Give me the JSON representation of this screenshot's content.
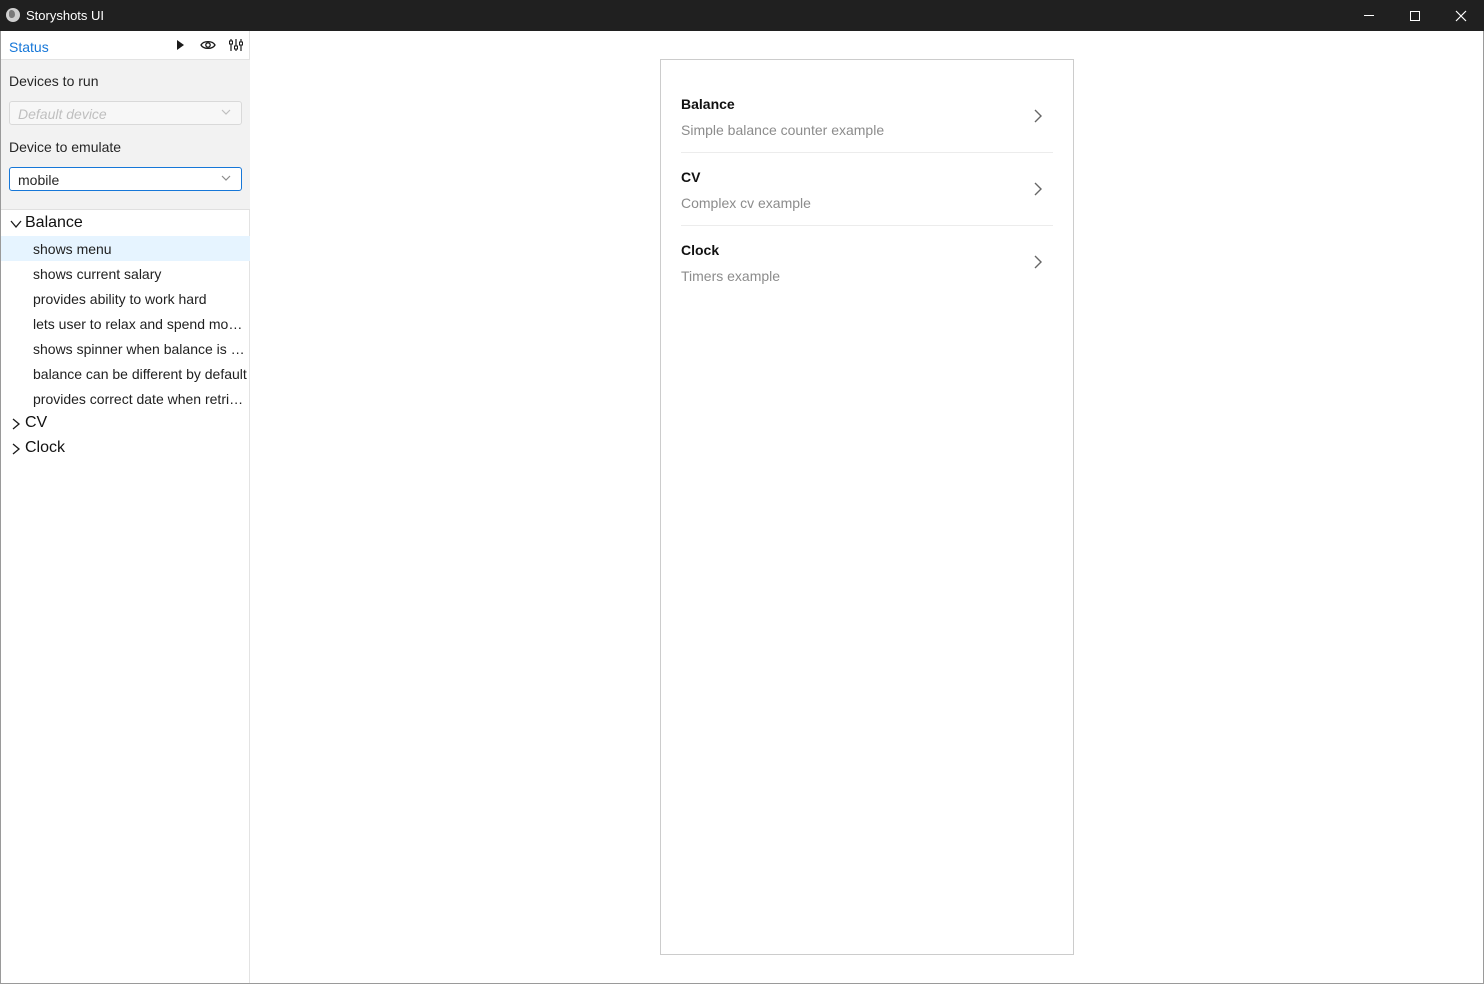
{
  "window": {
    "title": "Storyshots UI"
  },
  "toolbar": {
    "status_label": "Status"
  },
  "settings": {
    "devices_to_run_label": "Devices to run",
    "devices_to_run_placeholder": "Default device",
    "device_to_emulate_label": "Device to emulate",
    "device_to_emulate_value": "mobile"
  },
  "tree": {
    "groups": [
      {
        "label": "Balance",
        "expanded": true,
        "stories": [
          {
            "label": "shows menu",
            "selected": true
          },
          {
            "label": "shows current salary"
          },
          {
            "label": "provides ability to work hard"
          },
          {
            "label": "lets user to relax and spend money"
          },
          {
            "label": "shows spinner when balance is not loaded"
          },
          {
            "label": "balance can be different by default"
          },
          {
            "label": "provides correct date when retrieved"
          }
        ]
      },
      {
        "label": "CV",
        "expanded": false
      },
      {
        "label": "Clock",
        "expanded": false
      }
    ]
  },
  "preview": {
    "items": [
      {
        "title": "Balance",
        "description": "Simple balance counter example"
      },
      {
        "title": "CV",
        "description": "Complex cv example"
      },
      {
        "title": "Clock",
        "description": "Timers example"
      }
    ]
  },
  "colors": {
    "accent": "#1677d8",
    "selected_row": "#e6f4ff",
    "titlebar": "#202020"
  }
}
